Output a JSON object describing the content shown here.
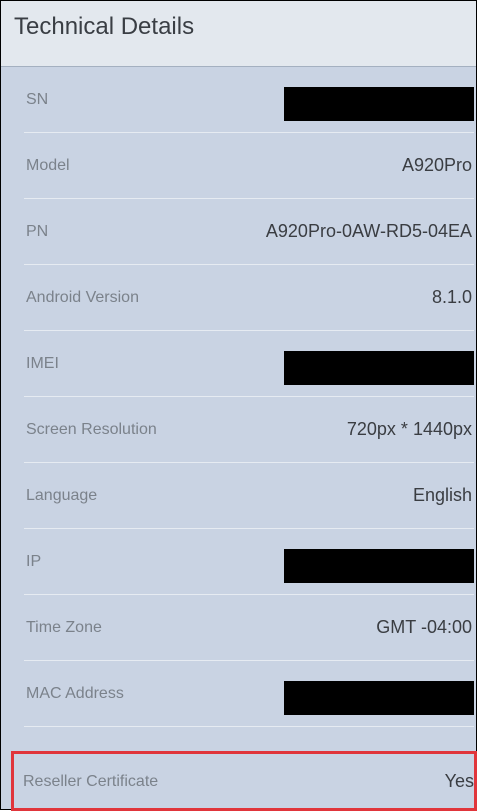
{
  "panel": {
    "title": "Technical Details"
  },
  "rows": [
    {
      "label": "SN",
      "value": "",
      "redacted": true
    },
    {
      "label": "Model",
      "value": "A920Pro",
      "redacted": false
    },
    {
      "label": "PN",
      "value": "A920Pro-0AW-RD5-04EA",
      "redacted": false
    },
    {
      "label": "Android Version",
      "value": "8.1.0",
      "redacted": false
    },
    {
      "label": "IMEI",
      "value": "",
      "redacted": true
    },
    {
      "label": "Screen Resolution",
      "value": "720px * 1440px",
      "redacted": false
    },
    {
      "label": "Language",
      "value": "English",
      "redacted": false
    },
    {
      "label": "IP",
      "value": "",
      "redacted": true
    },
    {
      "label": "Time Zone",
      "value": "GMT -04:00",
      "redacted": false
    },
    {
      "label": "MAC Address",
      "value": "",
      "redacted": true
    },
    {
      "label": "Reseller Certificate",
      "value": "Yes",
      "redacted": false,
      "highlighted": true
    }
  ],
  "colors": {
    "panel_background": "#c9d3e3",
    "header_background": "#e3e8ee",
    "highlight_border": "#e0353b",
    "redaction": "#000000"
  }
}
